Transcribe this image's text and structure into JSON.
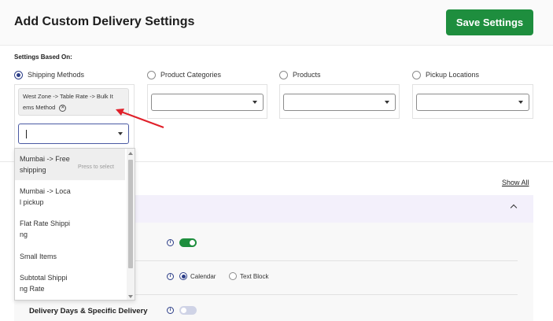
{
  "header": {
    "title": "Add Custom Delivery Settings",
    "save_label": "Save Settings"
  },
  "settings": {
    "based_on_label": "Settings Based On:",
    "options": [
      {
        "label": "Shipping Methods",
        "checked": true
      },
      {
        "label": "Product Categories",
        "checked": false
      },
      {
        "label": "Products",
        "checked": false
      },
      {
        "label": "Pickup Locations",
        "checked": false
      }
    ]
  },
  "shipping": {
    "selected_chip_line1": "West Zone -> Table Rate -> Bulk It",
    "selected_chip_line2": "ems Method",
    "search_value": ""
  },
  "dropdown": {
    "press_hint": "Press to select",
    "items": [
      {
        "line1": "Mumbai -> Free",
        "line2": "shipping"
      },
      {
        "line1": "Mumbai -> Loca",
        "line2": "l pickup"
      },
      {
        "line1": "Flat Rate Shippi",
        "line2": "ng"
      },
      {
        "line1": "Small Items",
        "line2": ""
      },
      {
        "line1": "Subtotal Shippi",
        "line2": "ng Rate"
      }
    ]
  },
  "section": {
    "show_all": "Show All",
    "calendar_label": "Calendar",
    "text_block_label": "Text Block",
    "delivery_days_label": "Delivery Days & Specific Delivery"
  },
  "colors": {
    "accent_green": "#1e8e3e",
    "radio_blue": "#2c3e88",
    "arrow_red": "#e0202a",
    "accordion_bg": "#f3f0fb"
  }
}
